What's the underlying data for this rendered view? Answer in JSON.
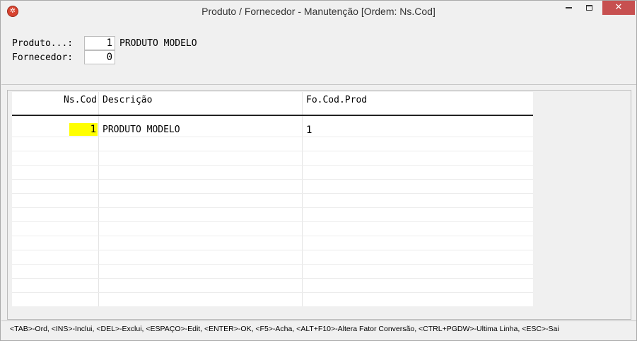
{
  "window": {
    "title": "Produto / Fornecedor - Manutenção [Ordem: Ns.Cod]",
    "close_glyph": "✕"
  },
  "form": {
    "produto_label": "Produto...:",
    "produto_value": "1",
    "produto_name": "PRODUTO MODELO",
    "fornecedor_label": "Fornecedor:",
    "fornecedor_value": "0"
  },
  "grid": {
    "columns": [
      "Ns.Cod",
      "Descrição",
      "Fo.Cod.Prod"
    ],
    "rows": [
      {
        "ns_cod": "1",
        "descricao": "PRODUTO MODELO",
        "fo_cod_prod": "1"
      }
    ],
    "highlight_color": "#ffff00"
  },
  "status": {
    "text": "<TAB>-Ord, <INS>-Inclui, <DEL>-Exclui, <ESPAÇO>-Edit, <ENTER>-OK, <F5>-Acha, <ALT+F10>-Altera Fator Conversão, <CTRL+PGDW>-Ultima Linha, <ESC>-Sai"
  }
}
